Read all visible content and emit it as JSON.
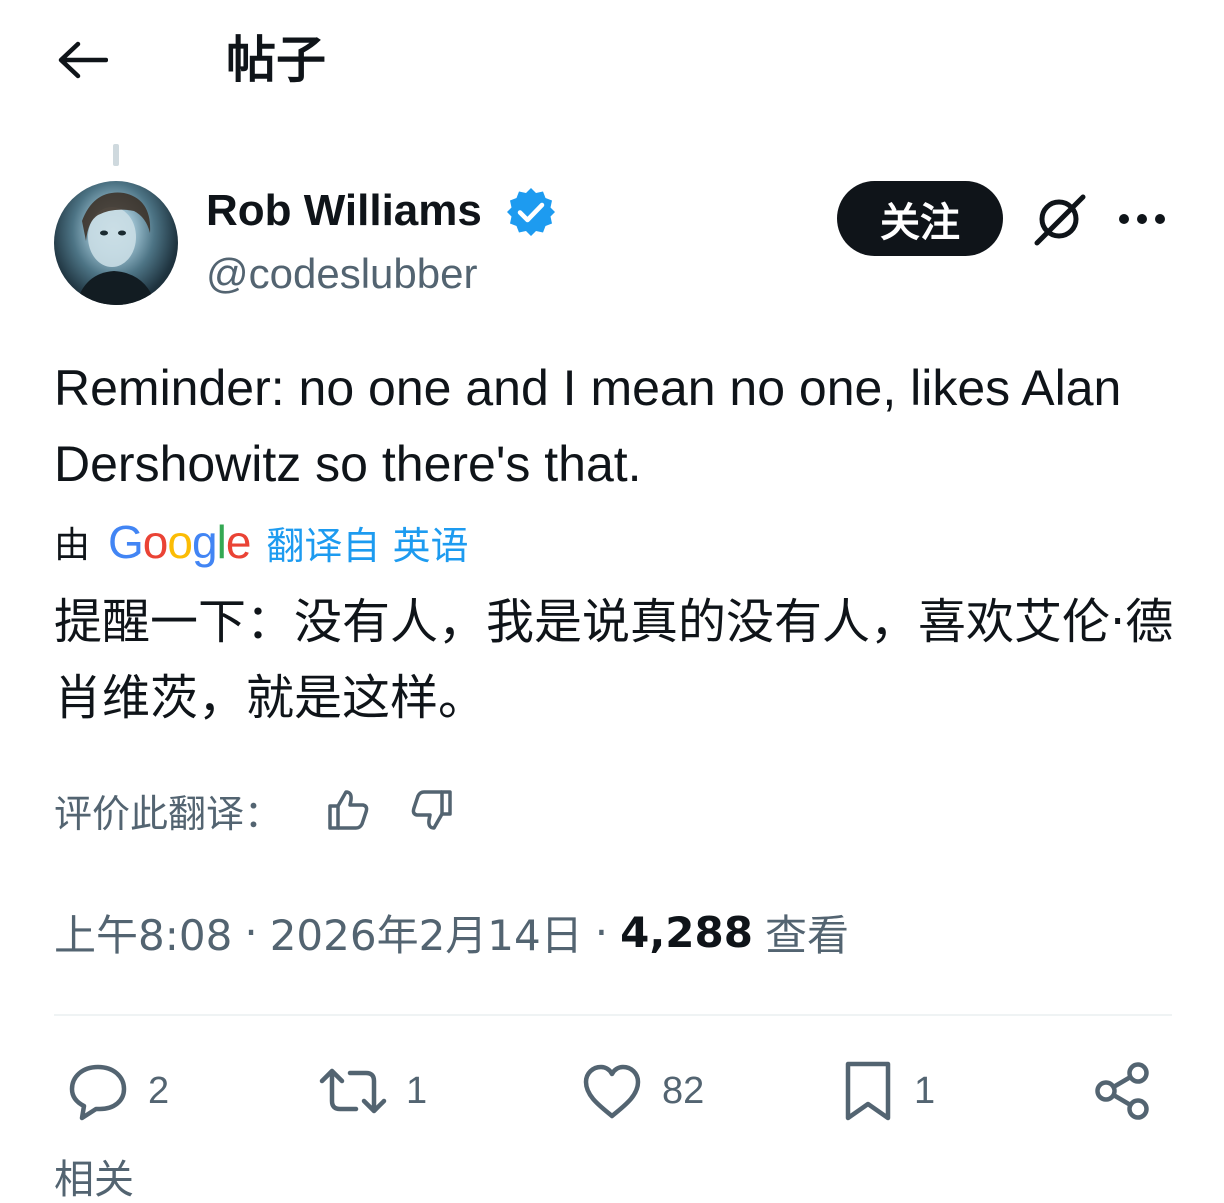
{
  "header": {
    "title": "帖子",
    "back_icon": "arrow-left-icon"
  },
  "author": {
    "name": "Rob Williams",
    "handle": "@codeslubber",
    "verified": true,
    "badge_color": "#1d9bf0"
  },
  "actions_top": {
    "follow_label": "关注",
    "grok_icon": "grok-icon",
    "more_icon": "more-dots-icon"
  },
  "post": {
    "text": "Reminder: no one and I mean no one, likes Alan Dershowitz so there's that."
  },
  "translation": {
    "by_label": "由",
    "provider": "Google",
    "from_label": "翻译自 英语",
    "text": "提醒一下：没有人，我是说真的没有人，喜欢艾伦·德肖维茨，就是这样。",
    "rate_label": "评价此翻译："
  },
  "meta": {
    "time": "上午8:08",
    "separator": "·",
    "date": "2026年2月14日",
    "views_count": "4,288",
    "views_label": "查看"
  },
  "engagement": {
    "replies": "2",
    "retweets": "1",
    "likes": "82",
    "bookmarks": "1"
  },
  "peek": {
    "text": "相关"
  },
  "colors": {
    "text_primary": "#0f1419",
    "text_secondary": "#536471",
    "accent": "#1d9bf0"
  }
}
